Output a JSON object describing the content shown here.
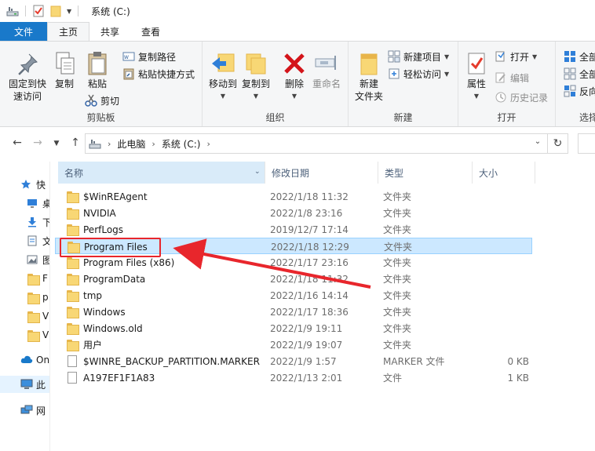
{
  "window": {
    "title": "系统 (C:)"
  },
  "tabs": [
    {
      "label": "文件"
    },
    {
      "label": "主页"
    },
    {
      "label": "共享"
    },
    {
      "label": "查看"
    }
  ],
  "ribbon": {
    "clipboard": {
      "label": "剪贴板",
      "pin": "固定到快速访问",
      "pin_line1": "固定到快",
      "pin_line2": "速访问",
      "copy": "复制",
      "paste": "粘贴",
      "copy_path": "复制路径",
      "paste_shortcut": "粘贴快捷方式",
      "cut": "剪切"
    },
    "organize": {
      "label": "组织",
      "move_to": "移动到",
      "copy_to": "复制到",
      "delete": "删除",
      "rename": "重命名"
    },
    "new": {
      "label": "新建",
      "new_folder_line1": "新建",
      "new_folder_line2": "文件夹",
      "new_item": "新建项目",
      "easy_access": "轻松访问"
    },
    "open": {
      "label": "打开",
      "properties": "属性",
      "open": "打开",
      "edit": "编辑",
      "history": "历史记录"
    },
    "select": {
      "label": "选择",
      "select_all": "全部",
      "select_none": "全部",
      "invert": "反向"
    }
  },
  "address": {
    "crumbs": [
      "此电脑",
      "系统 (C:)"
    ]
  },
  "navpane": {
    "items": [
      {
        "label": "快",
        "icon": "star-icon"
      },
      {
        "label": "桌",
        "icon": "desktop-icon"
      },
      {
        "label": "下",
        "icon": "download-icon"
      },
      {
        "label": "文",
        "icon": "document-icon"
      },
      {
        "label": "图",
        "icon": "picture-icon"
      },
      {
        "label": "F",
        "icon": "folder-icon"
      },
      {
        "label": "p",
        "icon": "folder-icon"
      },
      {
        "label": "V",
        "icon": "folder-icon"
      },
      {
        "label": "V",
        "icon": "folder-icon"
      },
      {
        "label": "On",
        "icon": "cloud-icon"
      },
      {
        "label": "此",
        "icon": "computer-icon"
      },
      {
        "label": "网",
        "icon": "network-icon"
      }
    ]
  },
  "columns": {
    "name": "名称",
    "date": "修改日期",
    "type": "类型",
    "size": "大小"
  },
  "files": [
    {
      "name": "$WinREAgent",
      "date": "2022/1/18 11:32",
      "type": "文件夹",
      "size": "",
      "kind": "folder"
    },
    {
      "name": "NVIDIA",
      "date": "2022/1/8 23:16",
      "type": "文件夹",
      "size": "",
      "kind": "folder"
    },
    {
      "name": "PerfLogs",
      "date": "2019/12/7 17:14",
      "type": "文件夹",
      "size": "",
      "kind": "folder"
    },
    {
      "name": "Program Files",
      "date": "2022/1/18 12:29",
      "type": "文件夹",
      "size": "",
      "kind": "folder"
    },
    {
      "name": "Program Files (x86)",
      "date": "2022/1/17 23:16",
      "type": "文件夹",
      "size": "",
      "kind": "folder"
    },
    {
      "name": "ProgramData",
      "date": "2022/1/18 11:32",
      "type": "文件夹",
      "size": "",
      "kind": "folder"
    },
    {
      "name": "tmp",
      "date": "2022/1/16 14:14",
      "type": "文件夹",
      "size": "",
      "kind": "folder"
    },
    {
      "name": "Windows",
      "date": "2022/1/17 18:36",
      "type": "文件夹",
      "size": "",
      "kind": "folder"
    },
    {
      "name": "Windows.old",
      "date": "2022/1/9 19:11",
      "type": "文件夹",
      "size": "",
      "kind": "folder"
    },
    {
      "name": "用户",
      "date": "2022/1/9 19:07",
      "type": "文件夹",
      "size": "",
      "kind": "folder"
    },
    {
      "name": "$WINRE_BACKUP_PARTITION.MARKER",
      "date": "2022/1/9 1:57",
      "type": "MARKER 文件",
      "size": "0 KB",
      "kind": "file"
    },
    {
      "name": "A197EF1F1A83",
      "date": "2022/1/13 2:01",
      "type": "文件",
      "size": "1 KB",
      "kind": "file"
    }
  ],
  "selected_row": 3,
  "colors": {
    "accent": "#1979ca",
    "selection": "#cce8ff",
    "annotation": "#e8262c"
  }
}
